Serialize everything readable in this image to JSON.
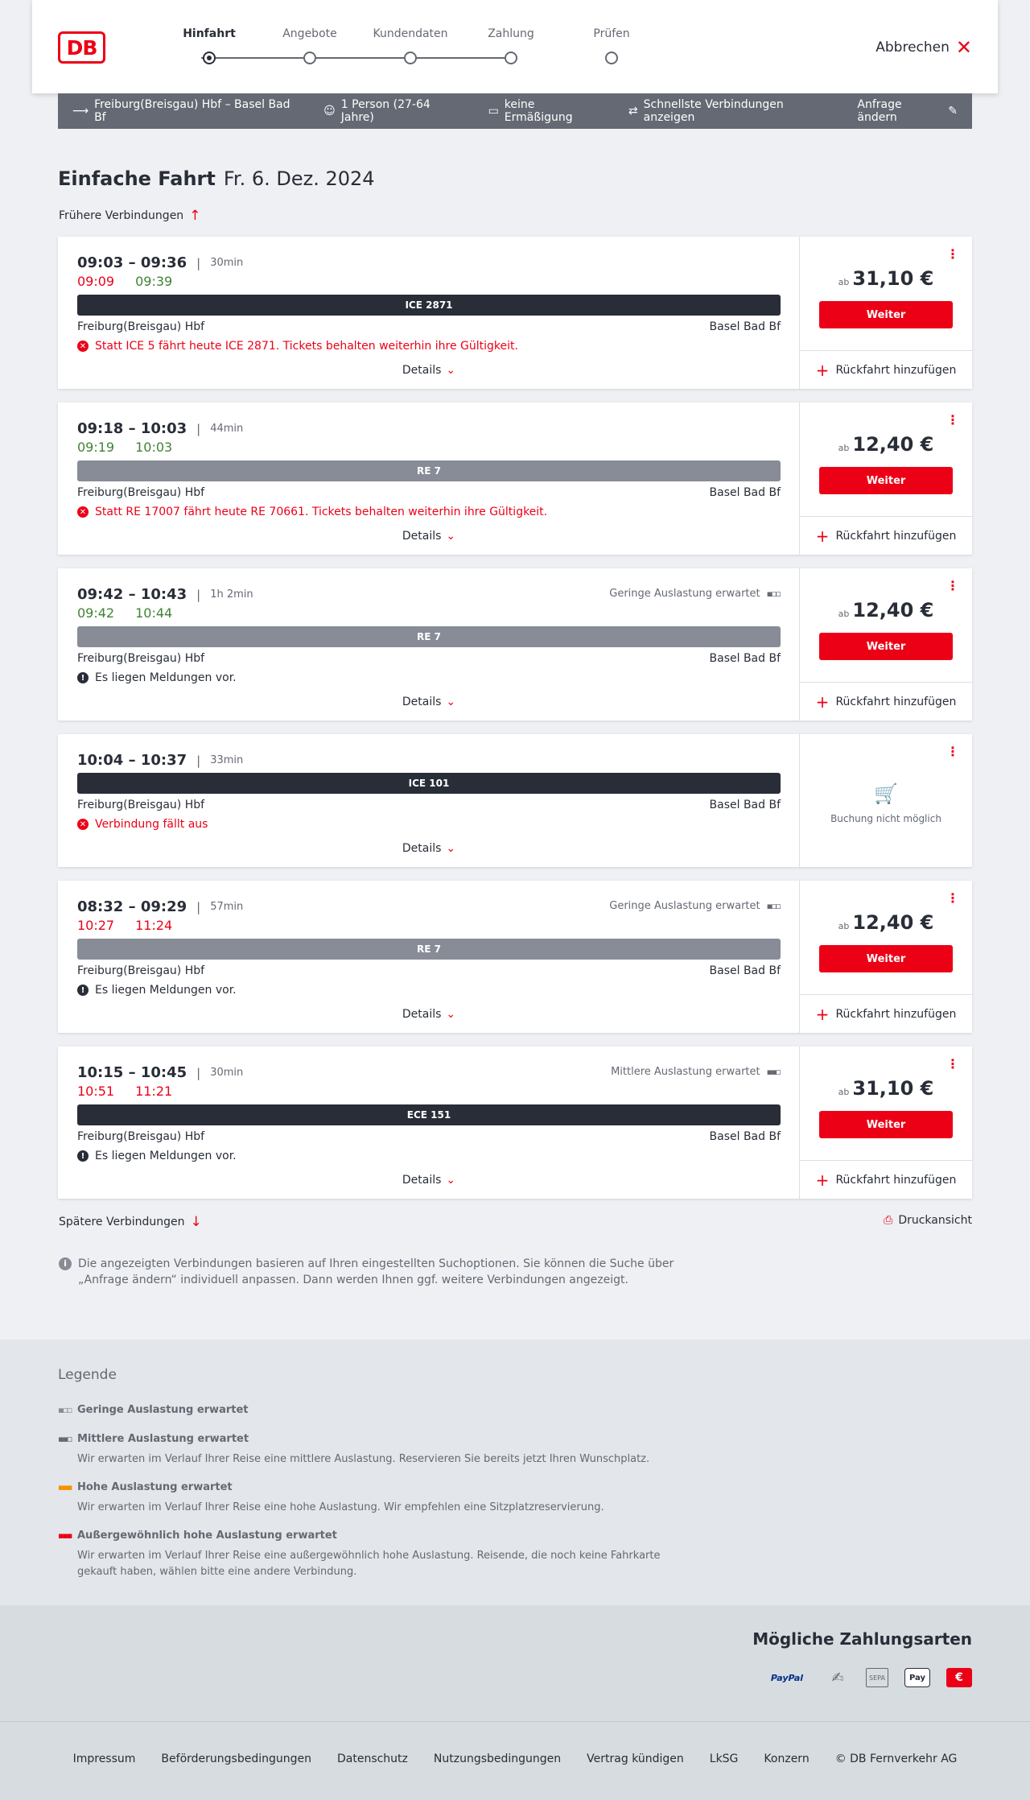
{
  "brand": {
    "logo_text": "DB",
    "accent": "#ec0016"
  },
  "stepper": {
    "steps": [
      "Hinfahrt",
      "Angebote",
      "Kundendaten",
      "Zahlung",
      "Prüfen"
    ],
    "active_index": 0
  },
  "header": {
    "cancel_label": "Abbrechen"
  },
  "filterbar": {
    "route": "Freiburg(Breisgau) Hbf – Basel Bad Bf",
    "passengers": "1 Person (27-64 Jahre)",
    "discount": "keine Ermäßigung",
    "option": "Schnellste Verbindungen anzeigen",
    "change_label": "Anfrage ändern"
  },
  "page": {
    "trip_type": "Einfache Fahrt",
    "date": "Fr. 6. Dez. 2024",
    "earlier_label": "Frühere Verbindungen",
    "later_label": "Spätere Verbindungen",
    "print_label": "Druckansicht",
    "note": "Die angezeigten Verbindungen basieren auf Ihren eingestellten Suchoptionen. Sie können die Suche über „Anfrage ändern“ individuell anpassen. Dann werden Ihnen ggf. weitere Verbindungen angezeigt."
  },
  "common": {
    "details_label": "Details",
    "ab_label": "ab",
    "weiter_label": "Weiter",
    "return_label": "Rückfahrt hinzufügen",
    "no_booking_label": "Buchung nicht möglich"
  },
  "connections": [
    {
      "planned": "09:03 – 09:36",
      "duration": "30min",
      "rt_dep": "09:09",
      "rt_arr": "09:39",
      "rt_dep_status": "late",
      "rt_arr_status": "ok",
      "load": "",
      "train": "ICE 2871",
      "train_style": "dark",
      "from": "Freiburg(Breisgau) Hbf",
      "to": "Basel Bad Bf",
      "msg": "Statt ICE 5 fährt heute ICE 2871. Tickets behalten weiterhin ihre Gültigkeit.",
      "msg_type": "err",
      "price": "31,10 €",
      "bookable": true
    },
    {
      "planned": "09:18 – 10:03",
      "duration": "44min",
      "rt_dep": "09:19",
      "rt_arr": "10:03",
      "rt_dep_status": "ok",
      "rt_arr_status": "ok",
      "load": "",
      "train": "RE 7",
      "train_style": "grey",
      "from": "Freiburg(Breisgau) Hbf",
      "to": "Basel Bad Bf",
      "msg": "Statt RE 17007 fährt heute RE 70661. Tickets behalten weiterhin ihre Gültigkeit.",
      "msg_type": "err",
      "price": "12,40 €",
      "bookable": true
    },
    {
      "planned": "09:42 – 10:43",
      "duration": "1h 2min",
      "rt_dep": "09:42",
      "rt_arr": "10:44",
      "rt_dep_status": "ok",
      "rt_arr_status": "ok",
      "load": "Geringe Auslastung erwartet",
      "train": "RE 7",
      "train_style": "grey",
      "from": "Freiburg(Breisgau) Hbf",
      "to": "Basel Bad Bf",
      "msg": "Es liegen Meldungen vor.",
      "msg_type": "info",
      "price": "12,40 €",
      "bookable": true
    },
    {
      "planned": "10:04 – 10:37",
      "duration": "33min",
      "rt_dep": "",
      "rt_arr": "",
      "rt_dep_status": "ok",
      "rt_arr_status": "ok",
      "load": "",
      "train": "ICE 101",
      "train_style": "dark",
      "from": "Freiburg(Breisgau) Hbf",
      "to": "Basel Bad Bf",
      "msg": "Verbindung fällt aus",
      "msg_type": "err",
      "price": "",
      "bookable": false
    },
    {
      "planned": "08:32 – 09:29",
      "duration": "57min",
      "rt_dep": "10:27",
      "rt_arr": "11:24",
      "rt_dep_status": "late",
      "rt_arr_status": "late",
      "load": "Geringe Auslastung erwartet",
      "train": "RE 7",
      "train_style": "grey",
      "from": "Freiburg(Breisgau) Hbf",
      "to": "Basel Bad Bf",
      "msg": "Es liegen Meldungen vor.",
      "msg_type": "info",
      "price": "12,40 €",
      "bookable": true
    },
    {
      "planned": "10:15 – 10:45",
      "duration": "30min",
      "rt_dep": "10:51",
      "rt_arr": "11:21",
      "rt_dep_status": "late",
      "rt_arr_status": "late",
      "load": "Mittlere Auslastung erwartet",
      "train": "ECE 151",
      "train_style": "dark",
      "from": "Freiburg(Breisgau) Hbf",
      "to": "Basel Bad Bf",
      "msg": "Es liegen Meldungen vor.",
      "msg_type": "info",
      "price": "31,10 €",
      "bookable": true
    }
  ],
  "legend": {
    "title": "Legende",
    "items": [
      {
        "title": "Geringe Auslastung erwartet",
        "desc": "",
        "color": "#878c96"
      },
      {
        "title": "Mittlere Auslastung erwartet",
        "desc": "Wir erwarten im Verlauf Ihrer Reise eine mittlere Auslastung. Reservieren Sie bereits jetzt Ihren Wunschplatz.",
        "color": "#646973"
      },
      {
        "title": "Hohe Auslastung erwartet",
        "desc": "Wir erwarten im Verlauf Ihrer Reise eine hohe Auslastung. Wir empfehlen eine Sitzplatzreservierung.",
        "color": "#f39200"
      },
      {
        "title": "Außergewöhnlich hohe Auslastung erwartet",
        "desc": "Wir erwarten im Verlauf Ihrer Reise eine außergewöhnlich hohe Auslastung. Reisende, die noch keine Fahrkarte gekauft haben, wählen bitte eine andere Verbindung.",
        "color": "#ec0016"
      }
    ]
  },
  "payment": {
    "title": "Mögliche Zahlungsarten",
    "methods": [
      "PayPal",
      "SEPA",
      "Pay"
    ]
  },
  "footer": {
    "links": [
      "Impressum",
      "Beförderungsbedingungen",
      "Datenschutz",
      "Nutzungsbedingungen",
      "Vertrag kündigen",
      "LkSG",
      "Konzern",
      "© DB Fernverkehr AG"
    ]
  }
}
